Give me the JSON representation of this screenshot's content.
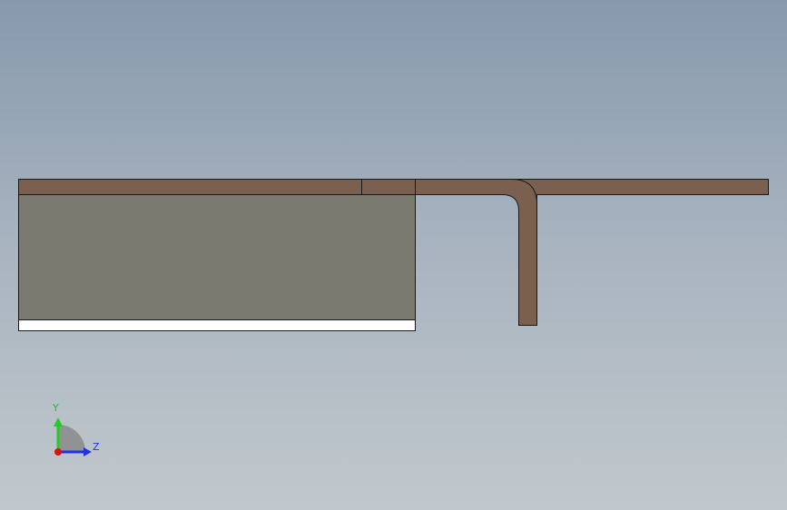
{
  "viewport": {
    "background_top": "#8799ad",
    "background_bottom": "#c1c8cd"
  },
  "model": {
    "plate_color": "#7b6050",
    "block_color": "#7a7a70",
    "base_strip_color": "#ffffff",
    "edge_color": "#1a1a1a"
  },
  "triad": {
    "y_label": "Y",
    "z_label": "Z",
    "y_color": "#22cc22",
    "z_color": "#2233dd",
    "origin_color": "#dd1111",
    "arc_color": "#8a8a8a"
  }
}
